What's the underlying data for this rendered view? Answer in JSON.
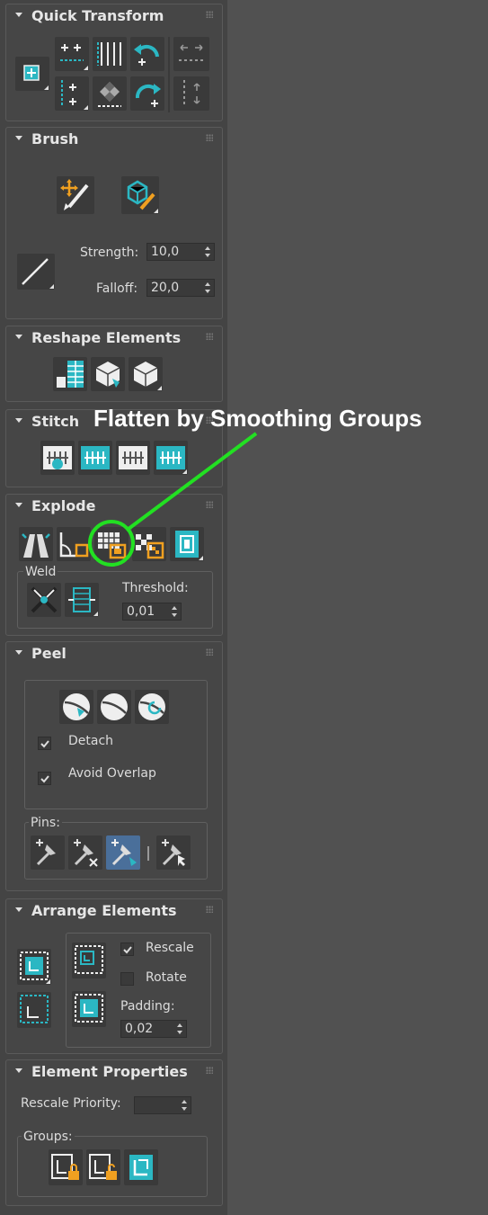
{
  "rollouts": {
    "quick_transform": {
      "title": "Quick Transform"
    },
    "brush": {
      "title": "Brush",
      "strength_label": "Strength:",
      "strength_value": "10,0",
      "falloff_label": "Falloff:",
      "falloff_value": "20,0"
    },
    "reshape": {
      "title": "Reshape Elements"
    },
    "stitch": {
      "title": "Stitch"
    },
    "explode": {
      "title": "Explode",
      "weld_label": "Weld",
      "threshold_label": "Threshold:",
      "threshold_value": "0,01"
    },
    "peel": {
      "title": "Peel",
      "detach_label": "Detach",
      "avoid_overlap_label": "Avoid Overlap",
      "pins_label": "Pins:"
    },
    "arrange": {
      "title": "Arrange Elements",
      "rescale_label": "Rescale",
      "rotate_label": "Rotate",
      "padding_label": "Padding:",
      "padding_value": "0,02"
    },
    "element_properties": {
      "title": "Element Properties",
      "rescale_priority_label": "Rescale Priority:",
      "rescale_priority_value": "",
      "groups_label": "Groups:"
    }
  },
  "checkboxes": {
    "detach": true,
    "avoid_overlap": true,
    "rescale": true,
    "rotate": false
  },
  "annotation": {
    "text": "Flatten by Smoothing Groups",
    "color": "#22e022"
  },
  "colors": {
    "accent": "#2bb7c3",
    "orange": "#f0a020",
    "panel": "#464646",
    "background": "#515151"
  }
}
